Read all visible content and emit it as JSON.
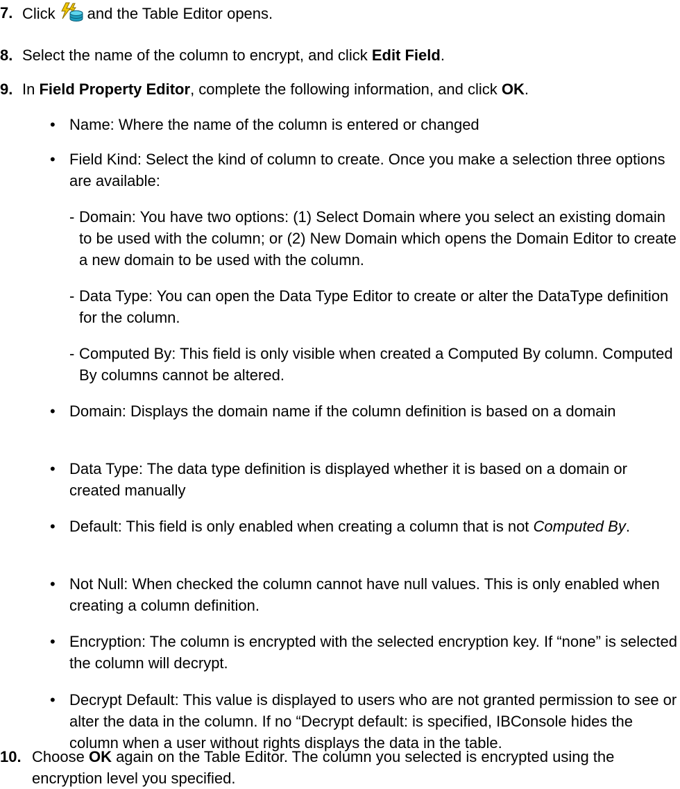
{
  "steps": [
    {
      "number": "7.",
      "parts": [
        "Click",
        "and the Table Editor opens."
      ],
      "icon": "lightning-database-icon"
    },
    {
      "number": "8.",
      "pre": "Select the name of the column to encrypt, and click ",
      "bold": "Edit Field",
      "post": "."
    },
    {
      "number": "9.",
      "pre": "In ",
      "bold1": "Field Property Editor",
      "mid": ", complete the following information, and click ",
      "bold2": "OK",
      "post": "."
    },
    {
      "number": "10.",
      "pre": "Choose ",
      "bold": "OK",
      "post": " again on the Table Editor. The column you selected is encrypted using the encryption level you specified."
    }
  ],
  "bullets": [
    {
      "marker": "•",
      "text": "Name: Where the name of the column is entered or changed"
    },
    {
      "marker": "•",
      "text": "Field Kind: Select the kind of column to create. Once you make a selection three options are available:"
    },
    {
      "marker": "•",
      "text": "Domain: Displays the domain name if the column definition is based on a domain"
    },
    {
      "marker": "•",
      "text": "Data Type: The data type definition is displayed whether it is based on a domain or created manually"
    },
    {
      "marker": "•",
      "pre": "Default: This field is only enabled when creating a column that is not ",
      "italic": "Computed By",
      "post": "."
    },
    {
      "marker": "•",
      "text": "Not Null: When checked the column cannot have null values. This is only enabled when creating a column definition."
    },
    {
      "marker": "•",
      "text": "Encryption: The column is encrypted with the selected encryption key. If “none” is selected the column will decrypt."
    },
    {
      "marker": "•",
      "text": "Decrypt Default: This value is displayed to users who are not granted permission to see or alter the data in the column. If no “Decrypt default: is specified, IBConsole hides the column when a user without rights displays the data in the table."
    }
  ],
  "subitems": [
    {
      "marker": "-",
      "text": "Domain: You have two options: (1) Select Domain where you select an existing domain to be used with the column; or (2) New Domain which opens the Domain Editor to create a new domain to be used with the column."
    },
    {
      "marker": "-",
      "text": "Data Type: You can open the Data Type Editor to create or alter the DataType definition for the column."
    },
    {
      "marker": "-",
      "text": "Computed By: This field is only visible when created a Computed By column. Computed By columns cannot be altered."
    }
  ]
}
